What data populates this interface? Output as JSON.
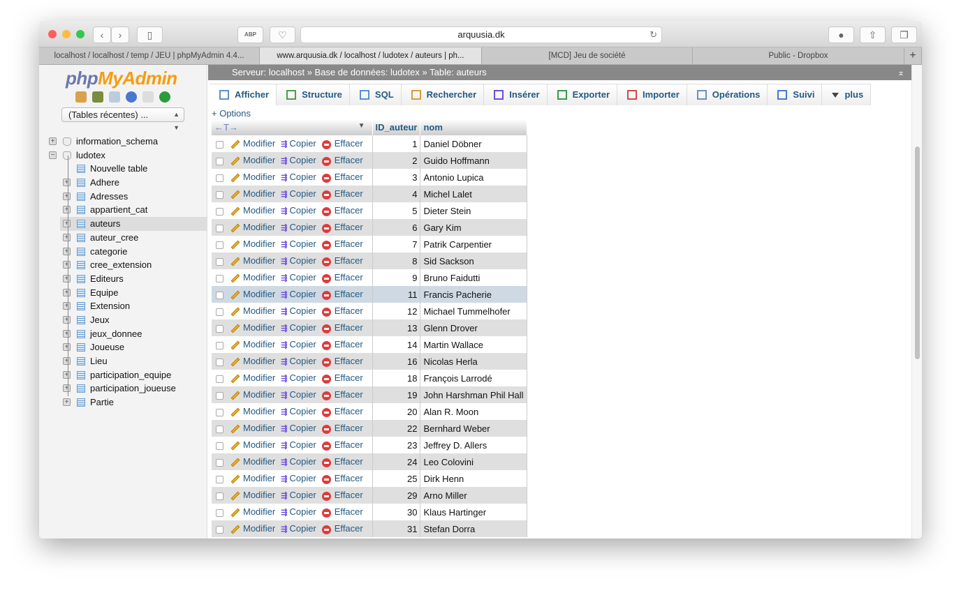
{
  "browser": {
    "url": "arquusia.dk",
    "abp": "ABP",
    "tabs": [
      "localhost / localhost / temp / JEU | phpMyAdmin 4.4...",
      "www.arquusia.dk / localhost / ludotex / auteurs | ph...",
      "[MCD] Jeu de société",
      "Public - Dropbox"
    ],
    "new_tab": "+"
  },
  "sidebar": {
    "logo_php": "php",
    "logo_myadmin": "MyAdmin",
    "recent": "(Tables récentes) ...",
    "databases": [
      {
        "label": "information_schema",
        "expanded": false
      },
      {
        "label": "ludotex",
        "expanded": true
      }
    ],
    "new_table": "Nouvelle table",
    "tables": [
      "Adhere",
      "Adresses",
      "appartient_cat",
      "auteurs",
      "auteur_cree",
      "categorie",
      "cree_extension",
      "Editeurs",
      "Equipe",
      "Extension",
      "Jeux",
      "jeux_donnee",
      "Joueuse",
      "Lieu",
      "participation_equipe",
      "participation_joueuse",
      "Partie"
    ],
    "selected": "auteurs"
  },
  "breadcrumb": {
    "server": "Serveur: localhost",
    "sep": "»",
    "database": "Base de données: ludotex",
    "table": "Table: auteurs"
  },
  "menu": [
    {
      "label": "Afficher",
      "icon": "browse-icon"
    },
    {
      "label": "Structure",
      "icon": "structure-icon"
    },
    {
      "label": "SQL",
      "icon": "sql-icon"
    },
    {
      "label": "Rechercher",
      "icon": "search-icon"
    },
    {
      "label": "Insérer",
      "icon": "insert-icon"
    },
    {
      "label": "Exporter",
      "icon": "export-icon"
    },
    {
      "label": "Importer",
      "icon": "import-icon"
    },
    {
      "label": "Opérations",
      "icon": "wrench-icon"
    },
    {
      "label": "Suivi",
      "icon": "eye-icon"
    },
    {
      "label": "plus",
      "icon": "triangle-down-icon"
    }
  ],
  "options": "+ Options",
  "table": {
    "columns": [
      "ID_auteur",
      "nom"
    ],
    "arrows": "←T→",
    "actions": {
      "edit": "Modifier",
      "copy": "Copier",
      "delete": "Effacer"
    },
    "highlight_row_id": "11",
    "rows": [
      [
        "1",
        "Daniel Döbner"
      ],
      [
        "2",
        "Guido Hoffmann"
      ],
      [
        "3",
        "Antonio Lupica"
      ],
      [
        "4",
        "Michel Lalet"
      ],
      [
        "5",
        "Dieter Stein"
      ],
      [
        "6",
        "Gary Kim"
      ],
      [
        "7",
        "Patrik Carpentier"
      ],
      [
        "8",
        "Sid Sackson"
      ],
      [
        "9",
        "Bruno Faidutti"
      ],
      [
        "11",
        "Francis Pacherie"
      ],
      [
        "12",
        "Michael Tummelhofer"
      ],
      [
        "13",
        "Glenn Drover"
      ],
      [
        "14",
        "Martin Wallace"
      ],
      [
        "16",
        "Nicolas Herla"
      ],
      [
        "18",
        "François Larrodé"
      ],
      [
        "19",
        "John Harshman Phil Hall"
      ],
      [
        "20",
        "Alan R. Moon"
      ],
      [
        "22",
        "Bernhard Weber"
      ],
      [
        "23",
        "Jeffrey D. Allers"
      ],
      [
        "24",
        "Leo Colovini"
      ],
      [
        "25",
        "Dirk Henn"
      ],
      [
        "29",
        "Arno Miller"
      ],
      [
        "30",
        "Klaus Hartinger"
      ],
      [
        "31",
        "Stefan Dorra"
      ]
    ]
  }
}
